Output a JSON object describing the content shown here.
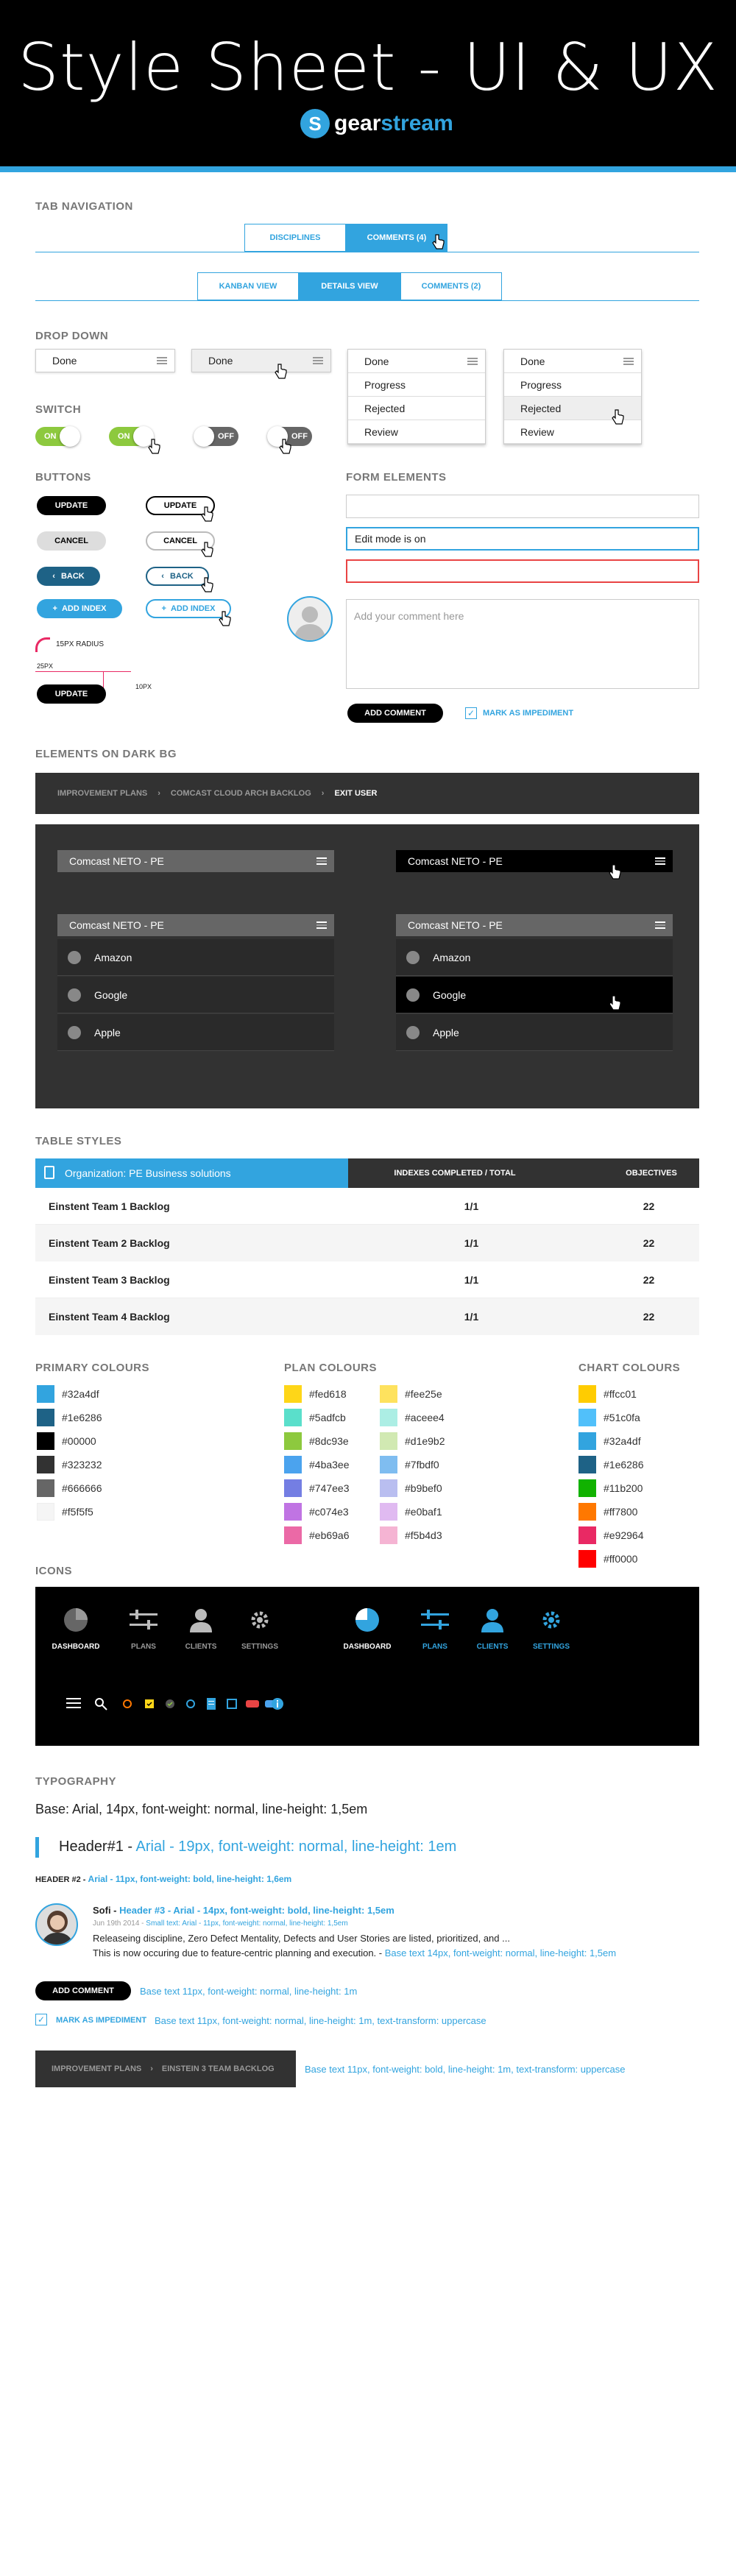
{
  "page_title": "Style Sheet - UI & UX",
  "logo": {
    "glyph": "S",
    "word1": "gear",
    "word2": "stream"
  },
  "sections": {
    "tab_navigation": "TAB NAVIGATION",
    "drop_down": "DROP DOWN",
    "switch": "SWITCH",
    "buttons": "BUTTONS",
    "form_elements": "FORM ELEMENTS",
    "elements_dark": "ELEMENTS ON DARK BG",
    "table_styles": "TABLE STYLES",
    "primary": "PRIMARY COLOURS",
    "plan": "PLAN COLOURS",
    "chart": "CHART COLOURS",
    "icons": "ICONS",
    "typography": "TYPOGRAPHY"
  },
  "tabs1": [
    {
      "label": "DISCIPLINES"
    },
    {
      "label": "COMMENTS (4)"
    }
  ],
  "tabs2": [
    {
      "label": "KANBAN VIEW"
    },
    {
      "label": "DETAILS VIEW"
    },
    {
      "label": "COMMENTS (2)"
    }
  ],
  "dropdown": {
    "selected": "Done",
    "options": [
      "Done",
      "Progress",
      "Rejected",
      "Review"
    ]
  },
  "switches": {
    "on": "ON",
    "off": "OFF"
  },
  "buttons": {
    "update": "UPDATE",
    "cancel": "CANCEL",
    "back": "BACK",
    "add_index": "ADD INDEX",
    "radius_label": "15PX RADIUS",
    "px25": "25PX",
    "px10": "10PX"
  },
  "form": {
    "edit_value": "Edit mode is on",
    "comment_placeholder": "Add your comment here",
    "add_comment": "ADD COMMENT",
    "impediment": "MARK AS IMPEDIMENT"
  },
  "breadcrumb": [
    "IMPROVEMENT PLANS",
    "COMCAST CLOUD ARCH BACKLOG",
    "EXIT USER"
  ],
  "dark_dropdown": {
    "title": "Comcast NETO - PE",
    "items": [
      "Amazon",
      "Google",
      "Apple"
    ]
  },
  "table": {
    "title": "Organization: PE Business solutions",
    "col2": "INDEXES COMPLETED / TOTAL",
    "col3": "OBJECTIVES",
    "rows": [
      {
        "name": "Einstent Team 1 Backlog",
        "idx": "1/1",
        "obj": "22"
      },
      {
        "name": "Einstent Team 2 Backlog",
        "idx": "1/1",
        "obj": "22"
      },
      {
        "name": "Einstent Team 3 Backlog",
        "idx": "1/1",
        "obj": "22"
      },
      {
        "name": "Einstent Team 4 Backlog",
        "idx": "1/1",
        "obj": "22"
      }
    ]
  },
  "primary_colours": [
    "#32a4df",
    "#1e6286",
    "#00000",
    "#323232",
    "#666666",
    "#f5f5f5"
  ],
  "primary_swatches": [
    "#32a4df",
    "#1e6286",
    "#000000",
    "#323232",
    "#666666",
    "#f5f5f5"
  ],
  "plan_colours_a": [
    "#fed618",
    "#5adfcb",
    "#8dc93e",
    "#4ba3ee",
    "#747ee3",
    "#c074e3",
    "#eb69a6"
  ],
  "plan_colours_b": [
    "#fee25e",
    "#aceee4",
    "#d1e9b2",
    "#7fbdf0",
    "#b9bef0",
    "#e0baf1",
    "#f5b4d3"
  ],
  "chart_colours": [
    "#ffcc01",
    "#51c0fa",
    "#32a4df",
    "#1e6286",
    "#11b200",
    "#ff7800",
    "#e92964",
    "#ff0000"
  ],
  "icons": {
    "labels": [
      "DASHBOARD",
      "PLANS",
      "CLIENTS",
      "SETTINGS"
    ]
  },
  "typo": {
    "base": "Base: Arial, 14px, font-weight: normal, line-height: 1,5em",
    "h1": "Header#1 -",
    "h1_spec": "Arial  - 19px, font-weight: normal, line-height: 1em",
    "h2": "HEADER #2 -",
    "h2_spec": "Arial - 11px, font-weight: bold, line-height: 1,6em",
    "name": "Sofi -",
    "h3_spec": "Header #3 - Arial - 14px, font-weight: bold, line-height: 1,5em",
    "date": "Jun 19th 2014 -",
    "small_spec": "Small text: Arial - 11px, font-weight: normal, line-height: 1,5em",
    "para1": "Releaseing discipline, Zero Defect Mentality, Defects and User Stories are listed, prioritized, and ...",
    "para2": "This is now occuring due to feature-centric planning and execution. -",
    "para2_spec": "Base text 14px, font-weight: normal, line-height: 1,5em",
    "btn_spec": "Base text 11px, font-weight: normal, line-height: 1m",
    "imp_spec": "Base text 11px, font-weight: normal, line-height: 1m, text-transform: uppercase",
    "crumb1": "IMPROVEMENT PLANS",
    "crumb2": "EINSTEIN 3 TEAM BACKLOG",
    "crumb_spec": "Base text 11px, font-weight: bold, line-height: 1m, text-transform: uppercase"
  }
}
